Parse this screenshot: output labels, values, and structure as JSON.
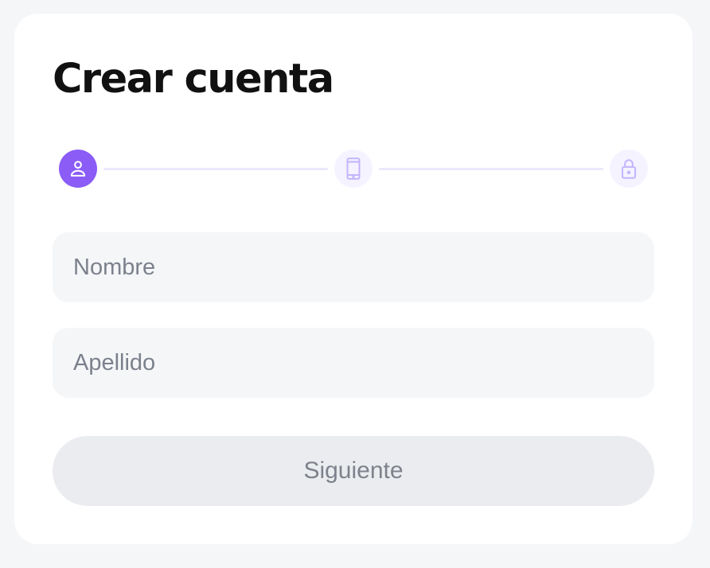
{
  "form": {
    "title": "Crear cuenta",
    "steps": [
      {
        "icon": "user-icon",
        "status": "active"
      },
      {
        "icon": "smartphone-icon",
        "status": "inactive"
      },
      {
        "icon": "lock-icon",
        "status": "inactive"
      }
    ],
    "fields": {
      "first_name": {
        "placeholder": "Nombre",
        "value": ""
      },
      "last_name": {
        "placeholder": "Apellido",
        "value": ""
      }
    },
    "next_button": {
      "label": "Siguiente",
      "enabled": false
    }
  },
  "colors": {
    "accent": "#8b5cf6",
    "accent_light": "#f5f3ff",
    "page_background": "#f5f6f8",
    "card_background": "#ffffff",
    "input_background": "#f5f6f8",
    "button_disabled_background": "#ebecef",
    "placeholder_text": "#7b818c",
    "title_text": "#111111"
  }
}
